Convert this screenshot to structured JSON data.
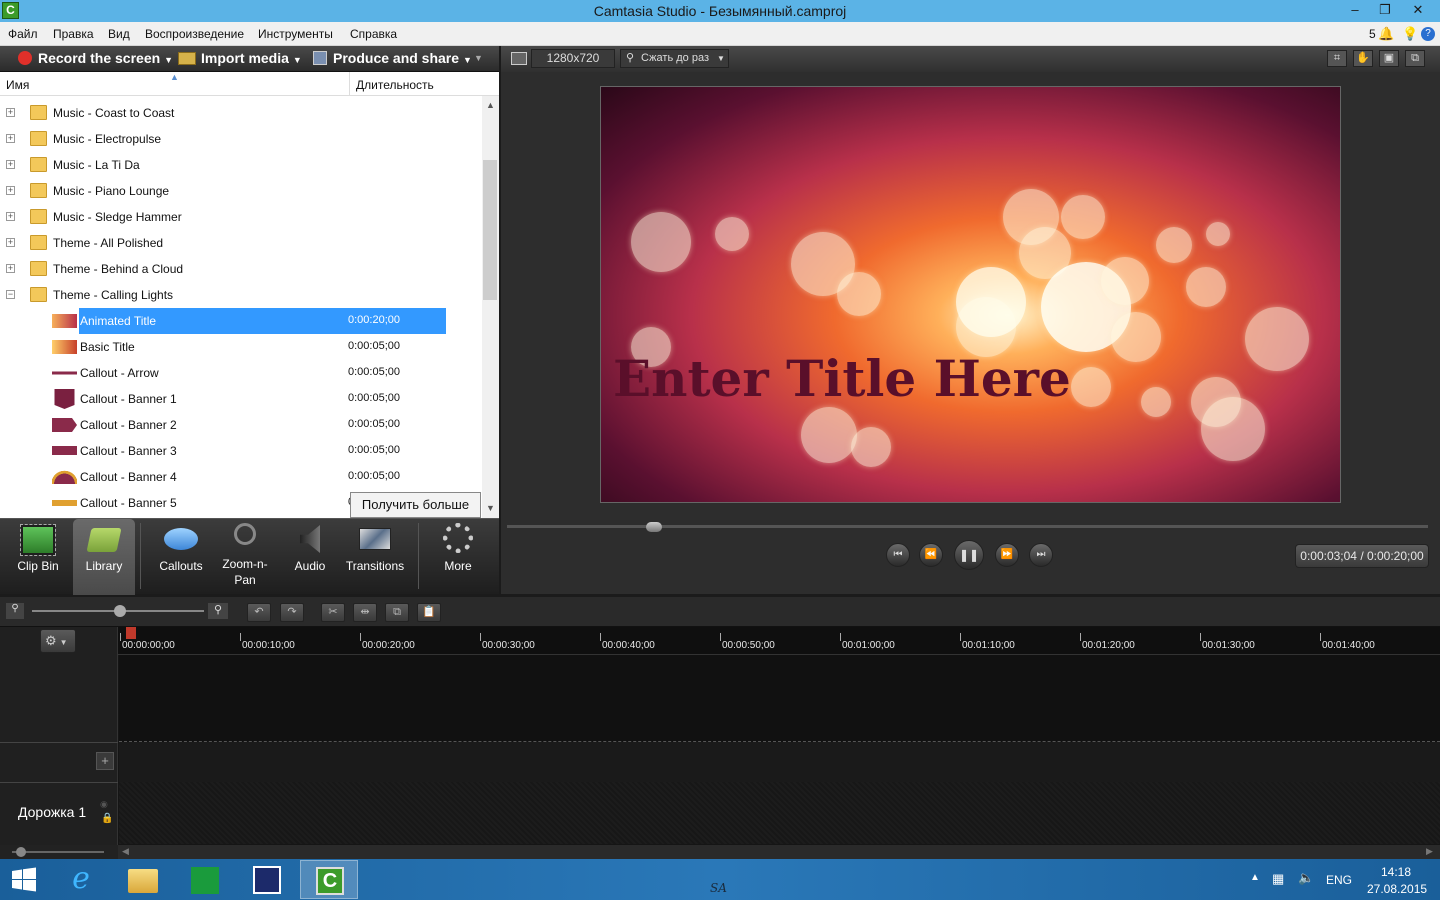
{
  "window": {
    "title": "Camtasia Studio - Безымянный.camproj",
    "app_icon": "C",
    "notification_count": "5"
  },
  "menu": [
    "Файл",
    "Правка",
    "Вид",
    "Воспроизведение",
    "Инструменты",
    "Справка"
  ],
  "toolbar": {
    "record": "Record the screen",
    "import": "Import media",
    "produce": "Produce and share"
  },
  "columns": {
    "name": "Имя",
    "duration": "Длительность"
  },
  "library_items": [
    {
      "name": "Music - Coast to Coast",
      "type": "folder",
      "expanded": false
    },
    {
      "name": "Music - Electropulse",
      "type": "folder",
      "expanded": false
    },
    {
      "name": "Music - La Ti Da",
      "type": "folder",
      "expanded": false
    },
    {
      "name": "Music - Piano Lounge",
      "type": "folder",
      "expanded": false
    },
    {
      "name": "Music - Sledge Hammer",
      "type": "folder",
      "expanded": false
    },
    {
      "name": "Theme - All Polished",
      "type": "folder",
      "expanded": false
    },
    {
      "name": "Theme - Behind a Cloud",
      "type": "folder",
      "expanded": false
    },
    {
      "name": "Theme - Calling Lights",
      "type": "folder",
      "expanded": true
    },
    {
      "name": "Animated Title",
      "type": "item",
      "duration": "0:00:20;00",
      "selected": true
    },
    {
      "name": "Basic Title",
      "type": "item",
      "duration": "0:00:05;00"
    },
    {
      "name": "Callout - Arrow",
      "type": "item",
      "duration": "0:00:05;00"
    },
    {
      "name": "Callout - Banner 1",
      "type": "item",
      "duration": "0:00:05;00"
    },
    {
      "name": "Callout - Banner 2",
      "type": "item",
      "duration": "0:00:05;00"
    },
    {
      "name": "Callout - Banner 3",
      "type": "item",
      "duration": "0:00:05;00"
    },
    {
      "name": "Callout - Banner 4",
      "type": "item",
      "duration": "0:00:05;00"
    },
    {
      "name": "Callout - Banner 5",
      "type": "item",
      "duration": "0"
    }
  ],
  "tooltip": "Получить больше",
  "tabs": [
    {
      "label": "Clip Bin",
      "icon": "film-icon"
    },
    {
      "label": "Library",
      "icon": "library-folder-icon",
      "active": true
    },
    {
      "label": "Callouts",
      "icon": "speech-bubble-icon"
    },
    {
      "label": "Zoom-n-Pan",
      "icon": "magnifier-icon"
    },
    {
      "label": "Audio",
      "icon": "speaker-icon"
    },
    {
      "label": "Transitions",
      "icon": "transition-icon"
    },
    {
      "label": "More",
      "icon": "dots-icon"
    }
  ],
  "preview": {
    "resolution": "1280x720",
    "fit": "Сжать до раз",
    "title_text": "Enter Title Here",
    "time": "0:00:03;04 / 0:00:20;00",
    "progress": 0.16
  },
  "timeline": {
    "ticks": [
      "00:00:00;00",
      "00:00:10;00",
      "00:00:20;00",
      "00:00:30;00",
      "00:00:40;00",
      "00:00:50;00",
      "00:01:00;00",
      "00:01:10;00",
      "00:01:20;00",
      "00:01:30;00",
      "00:01:40;00"
    ],
    "track_label": "Дорожка 1"
  },
  "taskbar": {
    "lang": "ENG",
    "time": "14:18",
    "date": "27.08.2015",
    "center_text": "SA"
  }
}
